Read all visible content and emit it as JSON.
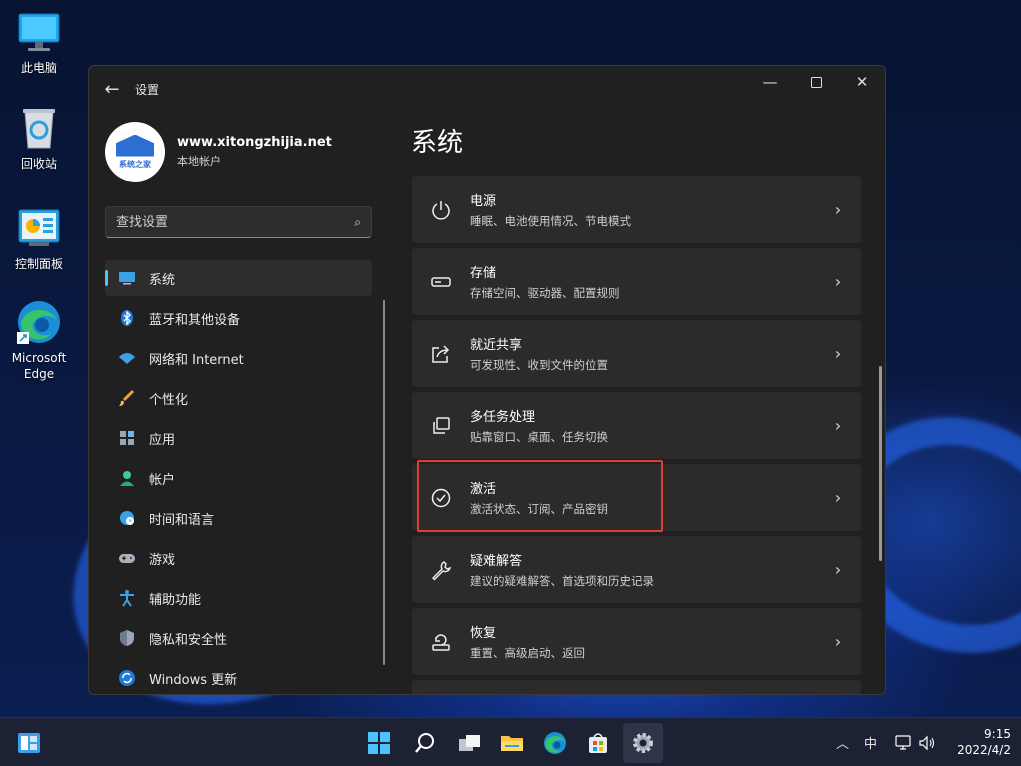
{
  "desktop": {
    "icons": [
      {
        "label": "此电脑"
      },
      {
        "label": "回收站"
      },
      {
        "label": "控制面板"
      },
      {
        "label": "Microsoft Edge"
      }
    ]
  },
  "window": {
    "title": "设置",
    "back_icon": "arrow-left-icon"
  },
  "profile": {
    "name": "www.xitongzhijia.net",
    "account_type": "本地帐户",
    "avatar_text": "系统之家"
  },
  "search": {
    "placeholder": "查找设置"
  },
  "nav": {
    "items": [
      {
        "label": "系统",
        "icon": "display-icon",
        "active": true
      },
      {
        "label": "蓝牙和其他设备",
        "icon": "bluetooth-icon"
      },
      {
        "label": "网络和 Internet",
        "icon": "wifi-icon"
      },
      {
        "label": "个性化",
        "icon": "brush-icon"
      },
      {
        "label": "应用",
        "icon": "apps-icon"
      },
      {
        "label": "帐户",
        "icon": "person-icon"
      },
      {
        "label": "时间和语言",
        "icon": "globe-clock-icon"
      },
      {
        "label": "游戏",
        "icon": "gamepad-icon"
      },
      {
        "label": "辅助功能",
        "icon": "accessibility-icon"
      },
      {
        "label": "隐私和安全性",
        "icon": "shield-icon"
      },
      {
        "label": "Windows 更新",
        "icon": "update-icon"
      }
    ]
  },
  "main": {
    "title": "系统",
    "cards": [
      {
        "title": "电源",
        "subtitle": "睡眠、电池使用情况、节电模式",
        "icon": "power-icon"
      },
      {
        "title": "存储",
        "subtitle": "存储空间、驱动器、配置规则",
        "icon": "storage-icon"
      },
      {
        "title": "就近共享",
        "subtitle": "可发现性、收到文件的位置",
        "icon": "share-icon"
      },
      {
        "title": "多任务处理",
        "subtitle": "贴靠窗口、桌面、任务切换",
        "icon": "multitask-icon"
      },
      {
        "title": "激活",
        "subtitle": "激活状态、订阅、产品密钥",
        "icon": "check-circle-icon"
      },
      {
        "title": "疑难解答",
        "subtitle": "建议的疑难解答、首选项和历史记录",
        "icon": "wrench-icon"
      },
      {
        "title": "恢复",
        "subtitle": "重置、高级启动、返回",
        "icon": "recovery-icon"
      }
    ]
  },
  "taskbar": {
    "input_indicator": "中",
    "time": "9:15",
    "date": "2022/4/2"
  },
  "colors": {
    "accent": "#4cc2ff",
    "highlight": "#e53935",
    "window_bg": "#202020",
    "card_bg": "#2b2b2b"
  }
}
